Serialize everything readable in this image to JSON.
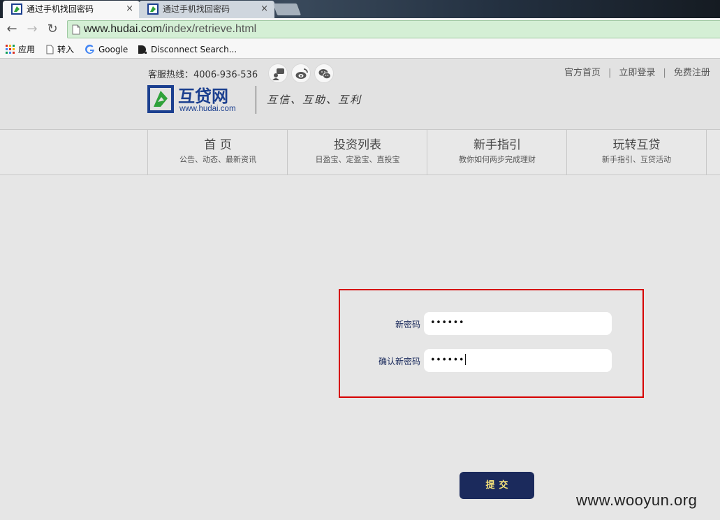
{
  "browser": {
    "tabs": [
      {
        "title": "通过手机找回密码",
        "active": true,
        "close": "×"
      },
      {
        "title": "通过手机找回密码",
        "active": false,
        "close": "×"
      }
    ],
    "nav": {
      "back": "←",
      "forward": "→",
      "reload": "↻"
    },
    "url_host": "www.hudai.com",
    "url_path": "/index/retrieve.html",
    "bookmarks": [
      {
        "label": "应用",
        "icon": "apps-grid-icon"
      },
      {
        "label": "转入",
        "icon": "page-icon"
      },
      {
        "label": "Google",
        "icon": "google-icon"
      },
      {
        "label": "Disconnect Search...",
        "icon": "disconnect-icon"
      }
    ]
  },
  "header": {
    "hotline": "客服热线：4006-936-536",
    "social_icons": [
      "chat-icon",
      "weibo-icon",
      "wechat-icon"
    ],
    "links": [
      "官方首页",
      "立即登录",
      "免费注册"
    ],
    "link_separator": "|",
    "logo_text": "互贷网",
    "logo_url": "www.hudai.com",
    "slogan": "互信、互助、互利"
  },
  "mainnav": [
    {
      "title": "首 页",
      "subtitle": "公告、动态、最新资讯"
    },
    {
      "title": "投资列表",
      "subtitle": "日盈宝、定盈宝、直投宝"
    },
    {
      "title": "新手指引",
      "subtitle": "教你如何两步完成理财"
    },
    {
      "title": "玩转互贷",
      "subtitle": "新手指引、互贷活动"
    }
  ],
  "form": {
    "new_password_label": "新密码",
    "new_password_value": "••••••",
    "confirm_password_label": "确认新密码",
    "confirm_password_value": "••••••",
    "submit_label": "提交"
  },
  "watermark": "www.wooyun.org",
  "colors": {
    "highlight_box": "#d60000",
    "submit_bg": "#1b2a5c",
    "submit_text": "#f6e27a",
    "omnibox_bg": "#d4efd5",
    "logo_green": "#2fa23a",
    "logo_blue": "#1b3f8f"
  }
}
